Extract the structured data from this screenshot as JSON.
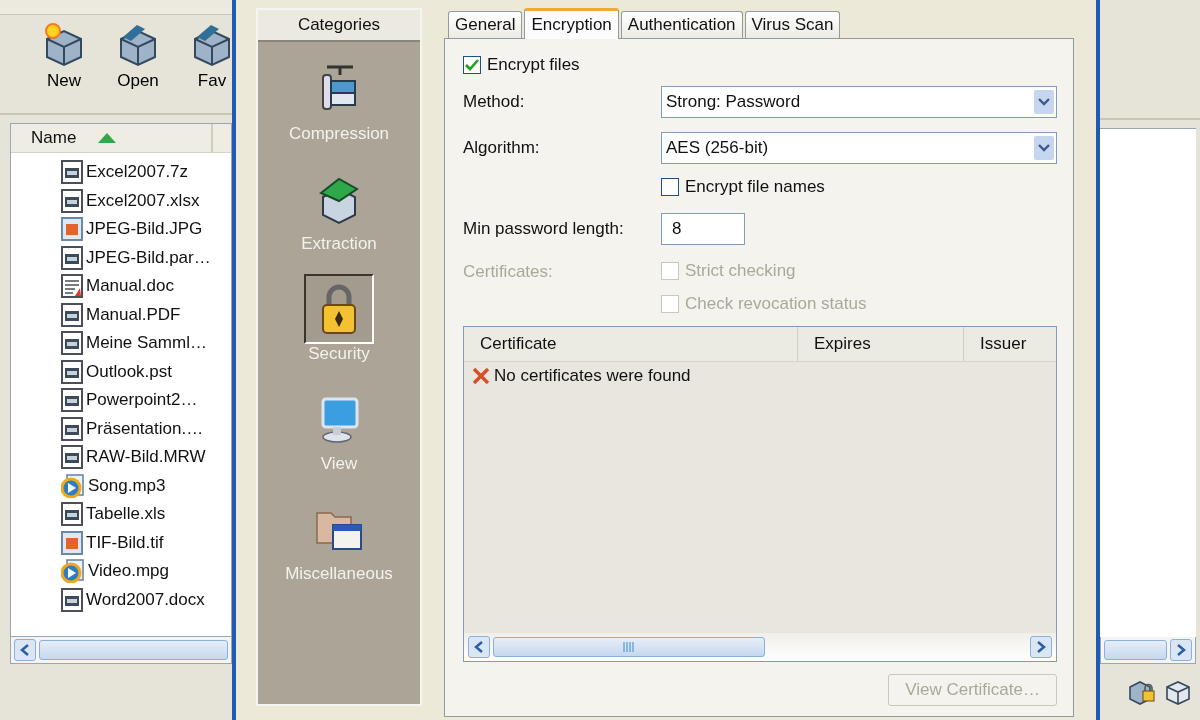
{
  "toolbar": {
    "buttons": [
      {
        "label": "New",
        "kind": "new"
      },
      {
        "label": "Open",
        "kind": "open"
      },
      {
        "label": "Fav",
        "kind": "open"
      }
    ]
  },
  "file_list": {
    "columns": [
      {
        "label": "Name",
        "sort_ascending": true
      }
    ],
    "files": [
      {
        "name": "Excel2007.7z",
        "kind": "generic"
      },
      {
        "name": "Excel2007.xlsx",
        "kind": "generic"
      },
      {
        "name": "JPEG-Bild.JPG",
        "kind": "image"
      },
      {
        "name": "JPEG-Bild.par…",
        "kind": "generic"
      },
      {
        "name": "Manual.doc",
        "kind": "text"
      },
      {
        "name": "Manual.PDF",
        "kind": "generic"
      },
      {
        "name": "Meine Samml…",
        "kind": "generic"
      },
      {
        "name": "Outlook.pst",
        "kind": "generic"
      },
      {
        "name": "Powerpoint2…",
        "kind": "generic"
      },
      {
        "name": "Präsentation.…",
        "kind": "generic"
      },
      {
        "name": "RAW-Bild.MRW",
        "kind": "generic"
      },
      {
        "name": "Song.mp3",
        "kind": "media"
      },
      {
        "name": "Tabelle.xls",
        "kind": "generic"
      },
      {
        "name": "TIF-Bild.tif",
        "kind": "image"
      },
      {
        "name": "Video.mpg",
        "kind": "media"
      },
      {
        "name": "Word2007.docx",
        "kind": "generic"
      }
    ]
  },
  "dialog": {
    "categories": {
      "title": "Categories",
      "items": [
        {
          "label": "Compression",
          "kind": "compression",
          "selected": false
        },
        {
          "label": "Extraction",
          "kind": "extraction",
          "selected": false
        },
        {
          "label": "Security",
          "kind": "security",
          "selected": true
        },
        {
          "label": "View",
          "kind": "view",
          "selected": false
        },
        {
          "label": "Miscellaneous",
          "kind": "misc",
          "selected": false
        }
      ]
    },
    "tabs": [
      {
        "label": "General",
        "selected": false
      },
      {
        "label": "Encryption",
        "selected": true
      },
      {
        "label": "Authentication",
        "selected": false
      },
      {
        "label": "Virus Scan",
        "selected": false
      }
    ],
    "encrypt_files": {
      "label": "Encrypt files",
      "checked": true,
      "disabled": false
    },
    "method": {
      "label": "Method:",
      "value": "Strong: Password"
    },
    "algorithm": {
      "label": "Algorithm:",
      "value": "AES (256-bit)"
    },
    "encrypt_file_names": {
      "label": "Encrypt file names",
      "checked": false,
      "disabled": false
    },
    "min_password_length": {
      "label": "Min password length:",
      "value": "8"
    },
    "certificates": {
      "label": "Certificates:",
      "disabled": true,
      "options": [
        {
          "label": "Strict checking",
          "checked": false,
          "disabled": true
        },
        {
          "label": "Check revocation status",
          "checked": false,
          "disabled": true
        }
      ]
    },
    "certificate_table": {
      "columns": [
        "Certificate",
        "Expires",
        "Issuer"
      ],
      "message": "No certificates were found"
    },
    "view_certificate_button": {
      "label": "View Certificate…",
      "disabled": true
    }
  }
}
